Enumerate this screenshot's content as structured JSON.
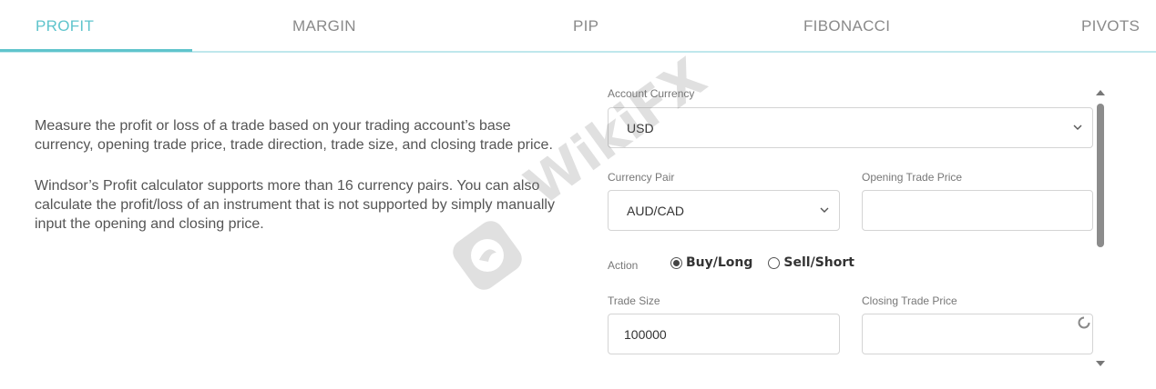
{
  "tabs": [
    {
      "label": "PROFIT",
      "active": true
    },
    {
      "label": "MARGIN",
      "active": false
    },
    {
      "label": "PIP",
      "active": false
    },
    {
      "label": "FIBONACCI",
      "active": false
    },
    {
      "label": "PIVOTS",
      "active": false
    }
  ],
  "description": {
    "paragraph1": "Measure the profit or loss of a trade based on your trading account’s base currency, opening trade price, trade direction, trade size, and closing trade price.",
    "paragraph2": "Windsor’s Profit calculator supports more than 16 currency pairs. You can also calculate the profit/loss of an instrument that is not supported by simply manually input the opening and closing price."
  },
  "form": {
    "account_currency": {
      "label": "Account Currency",
      "value": "USD"
    },
    "currency_pair": {
      "label": "Currency Pair",
      "value": "AUD/CAD"
    },
    "opening_price": {
      "label": "Opening Trade Price",
      "value": ""
    },
    "action": {
      "label": "Action",
      "options": [
        "Buy/Long",
        "Sell/Short"
      ],
      "selected": "Buy/Long"
    },
    "trade_size": {
      "label": "Trade Size",
      "value": "100000"
    },
    "closing_price": {
      "label": "Closing Trade Price",
      "value": ""
    }
  },
  "watermark": {
    "text": "WikiFX"
  },
  "colors": {
    "accent": "#5fc4cc",
    "tab_underline": "#bfe7ec"
  }
}
